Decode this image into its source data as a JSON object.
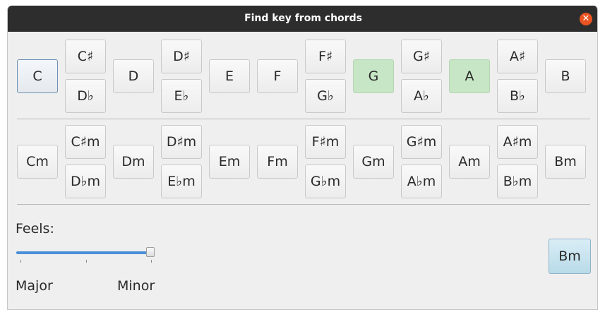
{
  "window": {
    "title": "Find key from chords",
    "close_label": "✕"
  },
  "major_chords": {
    "c": "C",
    "cs": "C♯",
    "db": "D♭",
    "d": "D",
    "ds": "D♯",
    "eb": "E♭",
    "e": "E",
    "f": "F",
    "fs": "F♯",
    "gb": "G♭",
    "g": "G",
    "gs": "G♯",
    "ab": "A♭",
    "a": "A",
    "as": "A♯",
    "bb": "B♭",
    "b": "B"
  },
  "minor_chords": {
    "cm": "Cm",
    "csm": "C♯m",
    "dbm": "D♭m",
    "dm": "Dm",
    "dsm": "D♯m",
    "ebm": "E♭m",
    "em": "Em",
    "fm": "Fm",
    "fsm": "F♯m",
    "gbm": "G♭m",
    "gm": "Gm",
    "gsm": "G♯m",
    "abm": "A♭m",
    "am": "Am",
    "asm": "A♯m",
    "bbm": "B♭m",
    "bm": "Bm"
  },
  "selected_colors": {
    "highlight": "#c7e6c5"
  },
  "feels": {
    "label": "Feels:",
    "min_label": "Major",
    "max_label": "Minor",
    "value": 1.0
  },
  "result": {
    "key": "Bm"
  }
}
